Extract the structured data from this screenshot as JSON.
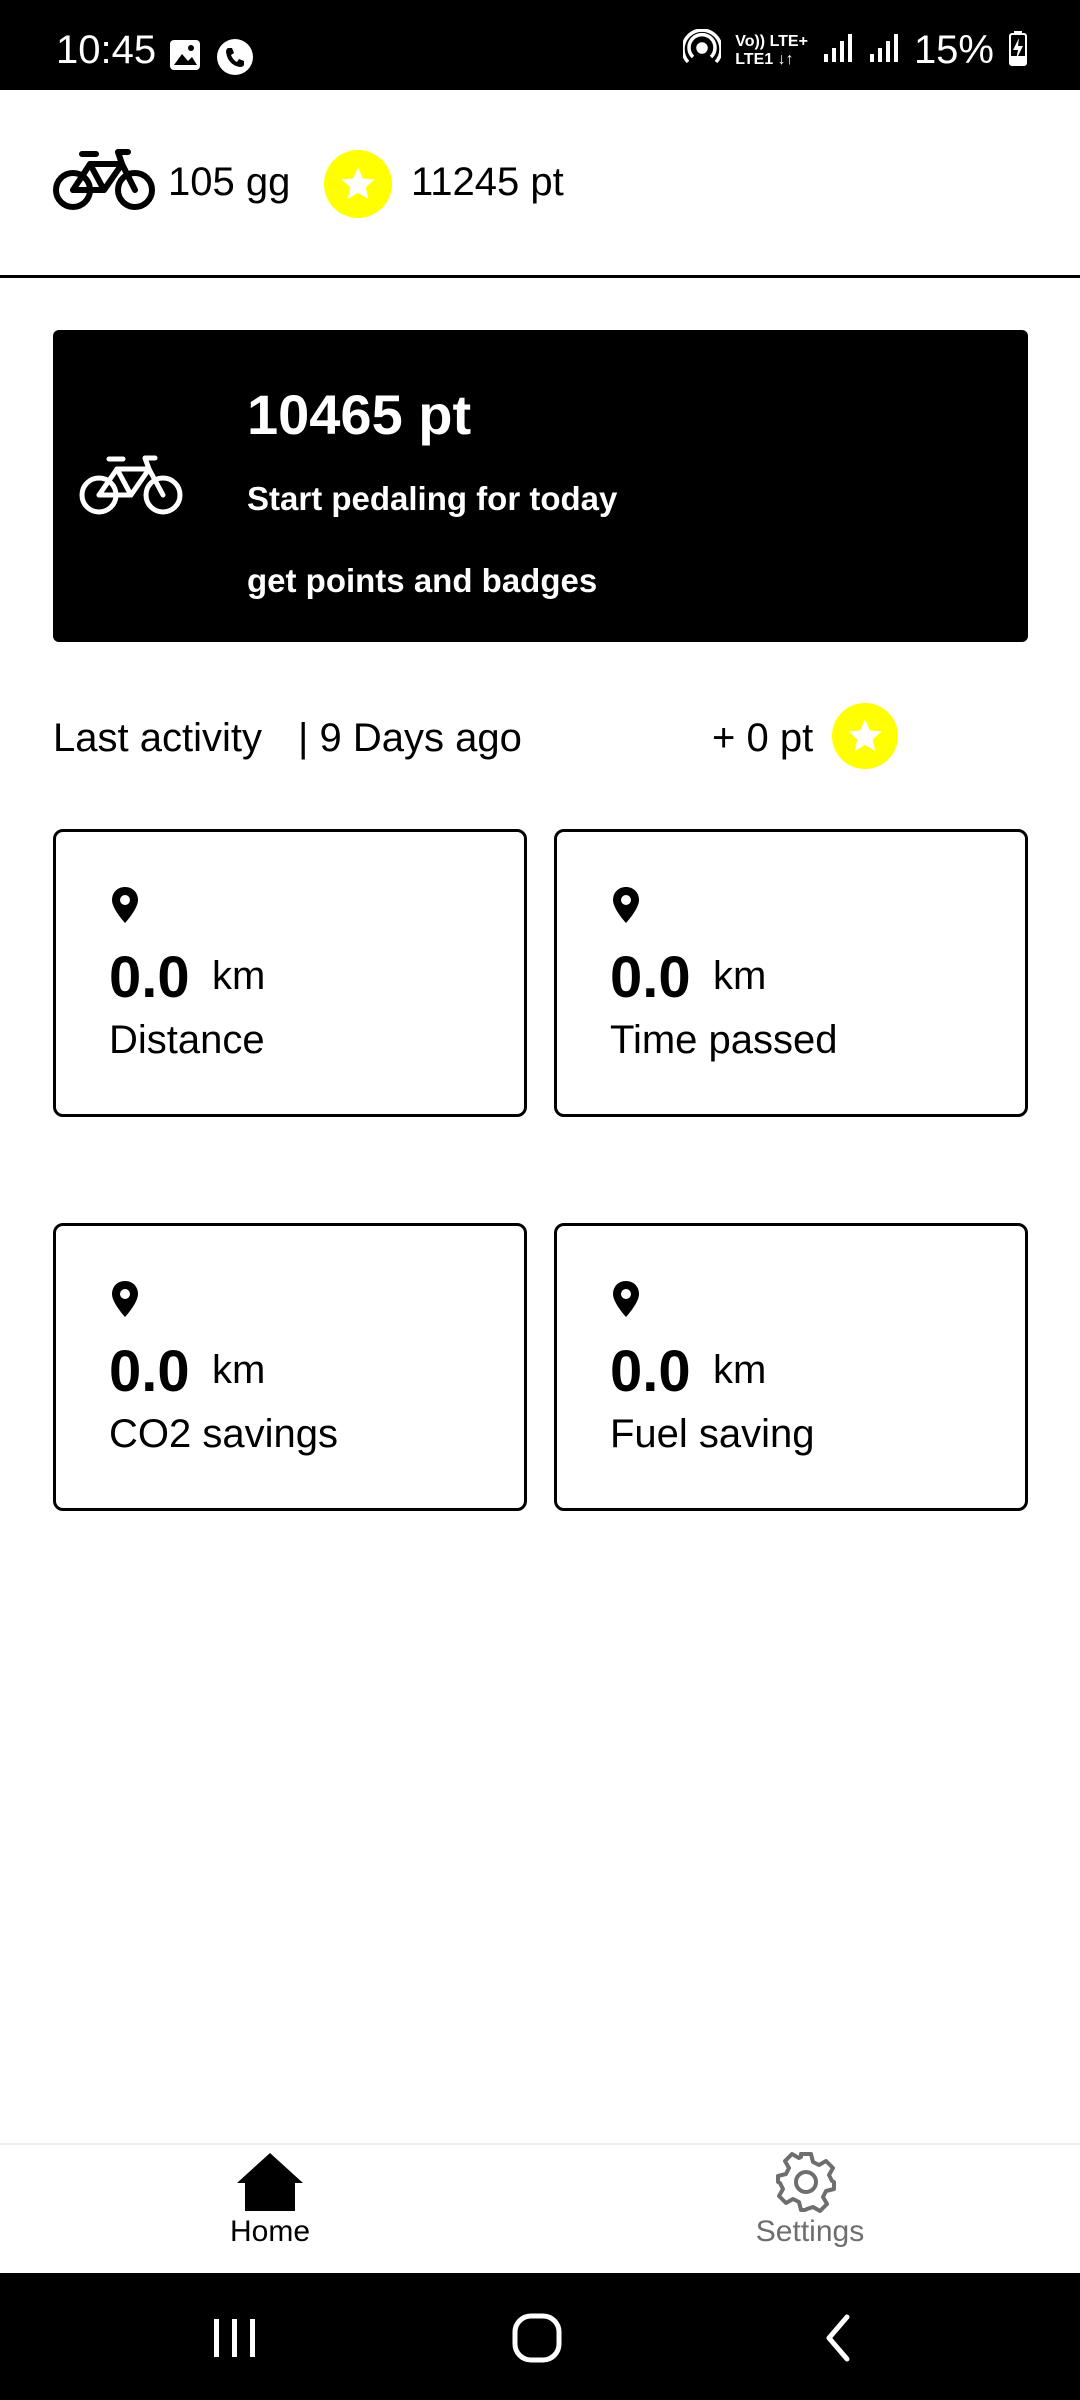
{
  "status_bar": {
    "time": "10:45",
    "network_top": "Vo)) LTE+",
    "network_bottom": "LTE1 ↓↑",
    "battery": "15%"
  },
  "header": {
    "days_text": "105 gg",
    "points_text": "11245 pt",
    "star_color": "#ffff00"
  },
  "hero": {
    "points": "10465 pt",
    "line1": "Start pedaling for today",
    "line2": "get points and badges"
  },
  "last_activity": {
    "label": "Last activity",
    "ago": "| 9 Days ago",
    "points": "+ 0 pt"
  },
  "stats": [
    {
      "value": "0.0",
      "unit": "km",
      "label": "Distance"
    },
    {
      "value": "0.0",
      "unit": "km",
      "label": "Time passed"
    },
    {
      "value": "0.0",
      "unit": "km",
      "label": "CO2 savings"
    },
    {
      "value": "0.0",
      "unit": "km",
      "label": "Fuel saving"
    }
  ],
  "bottom_nav": {
    "items": [
      {
        "label": "Home",
        "icon": "home-icon",
        "active": true
      },
      {
        "label": "Settings",
        "icon": "gear-icon",
        "active": false
      }
    ]
  },
  "system_nav": {
    "icons": [
      "recents-icon",
      "home-circle-icon",
      "back-icon"
    ]
  },
  "colors": {
    "accent_star": "#ffff00",
    "hero_bg": "#000000",
    "inactive_nav": "#6e6e6e"
  }
}
